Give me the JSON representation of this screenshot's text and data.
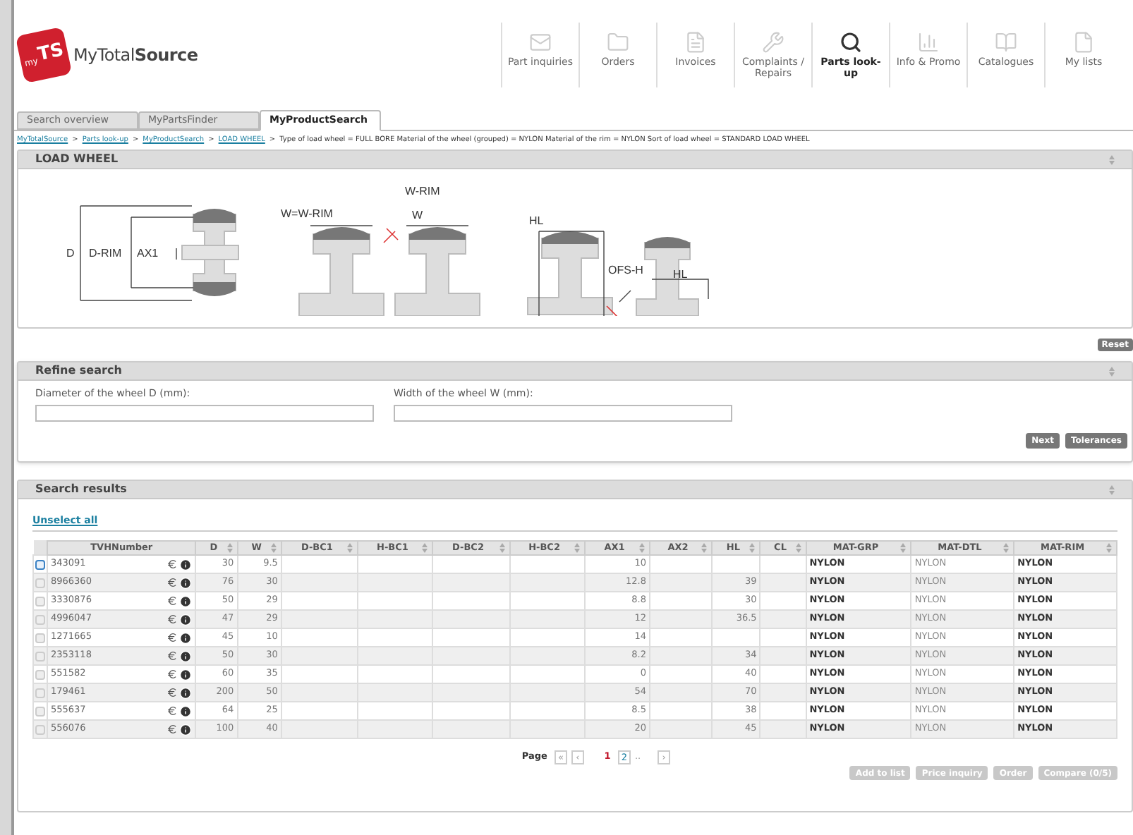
{
  "logo": {
    "badge_small": "my",
    "badge": "TS",
    "name": "MyTotal**Source**"
  },
  "nav": [
    {
      "label": "Part inquiries",
      "selected": false
    },
    {
      "label": "Orders",
      "selected": false
    },
    {
      "label": "Invoices",
      "selected": false
    },
    {
      "label": "Complaints / Repairs",
      "selected": false
    },
    {
      "label": "Parts look-up",
      "selected": true
    },
    {
      "label": "Info & Promo",
      "selected": false
    },
    {
      "label": "Catalogues",
      "selected": false
    },
    {
      "label": "My lists",
      "selected": false
    }
  ],
  "tabs": [
    {
      "label": "Search overview",
      "selected": false
    },
    {
      "label": "MyPartsFinder",
      "selected": false
    },
    {
      "label": "MyProductSearch",
      "selected": true
    }
  ],
  "breadcrumb": {
    "links": [
      "MyTotalSource",
      "Parts look-up",
      "MyProductSearch",
      "LOAD WHEEL"
    ],
    "separator": ">",
    "criteria": "Type of load wheel = FULL BORE Material of the wheel (grouped) = NYLON Material of the rim = NYLON Sort of load wheel = STANDARD LOAD WHEEL"
  },
  "load_wheel": {
    "title": "LOAD WHEEL",
    "labels": [
      "D",
      "D-RIM",
      "AX1",
      "W=W-RIM",
      "W-RIM",
      "W",
      "HL",
      "OFS-H",
      "HL"
    ]
  },
  "reset_button": "Reset",
  "refine": {
    "title": "Refine search",
    "fields": [
      {
        "label": "Diameter of the wheel D (mm):"
      },
      {
        "label": "Width of the wheel W (mm):"
      }
    ],
    "buttons": [
      "Next",
      "Tolerances"
    ]
  },
  "results": {
    "title": "Search results",
    "unselect_all": "Unselect all",
    "columns": [
      "TVHNumber",
      "D",
      "W",
      "D-BC1",
      "H-BC1",
      "D-BC2",
      "H-BC2",
      "AX1",
      "AX2",
      "HL",
      "CL",
      "MAT-GRP",
      "MAT-DTL",
      "MAT-RIM"
    ],
    "rows": [
      {
        "focused": true,
        "cells": [
          "343091",
          "30",
          "9.5",
          "",
          "",
          "",
          "",
          "10",
          "",
          "",
          "",
          "NYLON",
          "NYLON",
          "NYLON"
        ]
      },
      {
        "focused": false,
        "cells": [
          "8966360",
          "76",
          "30",
          "",
          "",
          "",
          "",
          "12.8",
          "",
          "39",
          "",
          "NYLON",
          "NYLON",
          "NYLON"
        ]
      },
      {
        "focused": false,
        "cells": [
          "3330876",
          "50",
          "29",
          "",
          "",
          "",
          "",
          "8.8",
          "",
          "30",
          "",
          "NYLON",
          "NYLON",
          "NYLON"
        ]
      },
      {
        "focused": false,
        "cells": [
          "4996047",
          "47",
          "29",
          "",
          "",
          "",
          "",
          "12",
          "",
          "36.5",
          "",
          "NYLON",
          "NYLON",
          "NYLON"
        ]
      },
      {
        "focused": false,
        "cells": [
          "1271665",
          "45",
          "10",
          "",
          "",
          "",
          "",
          "14",
          "",
          "",
          "",
          "NYLON",
          "NYLON",
          "NYLON"
        ]
      },
      {
        "focused": false,
        "cells": [
          "2353118",
          "50",
          "30",
          "",
          "",
          "",
          "",
          "8.2",
          "",
          "34",
          "",
          "NYLON",
          "NYLON",
          "NYLON"
        ]
      },
      {
        "focused": false,
        "cells": [
          "551582",
          "60",
          "35",
          "",
          "",
          "",
          "",
          "0",
          "",
          "40",
          "",
          "NYLON",
          "NYLON",
          "NYLON"
        ]
      },
      {
        "focused": false,
        "cells": [
          "179461",
          "200",
          "50",
          "",
          "",
          "",
          "",
          "54",
          "",
          "70",
          "",
          "NYLON",
          "NYLON",
          "NYLON"
        ]
      },
      {
        "focused": false,
        "cells": [
          "555637",
          "64",
          "25",
          "",
          "",
          "",
          "",
          "8.5",
          "",
          "38",
          "",
          "NYLON",
          "NYLON",
          "NYLON"
        ]
      },
      {
        "focused": false,
        "cells": [
          "556076",
          "100",
          "40",
          "",
          "",
          "",
          "",
          "20",
          "",
          "45",
          "",
          "NYLON",
          "NYLON",
          "NYLON"
        ]
      }
    ],
    "pagination": {
      "label": "Page",
      "first": "«",
      "prev": "‹",
      "pages": [
        {
          "label": "1",
          "selected": true
        },
        {
          "label": "2",
          "selected": false
        }
      ],
      "ellipsis": "..",
      "next": "›"
    },
    "actions": [
      "Add to list",
      "Price inquiry",
      "Order",
      "Compare (0/5)"
    ]
  }
}
